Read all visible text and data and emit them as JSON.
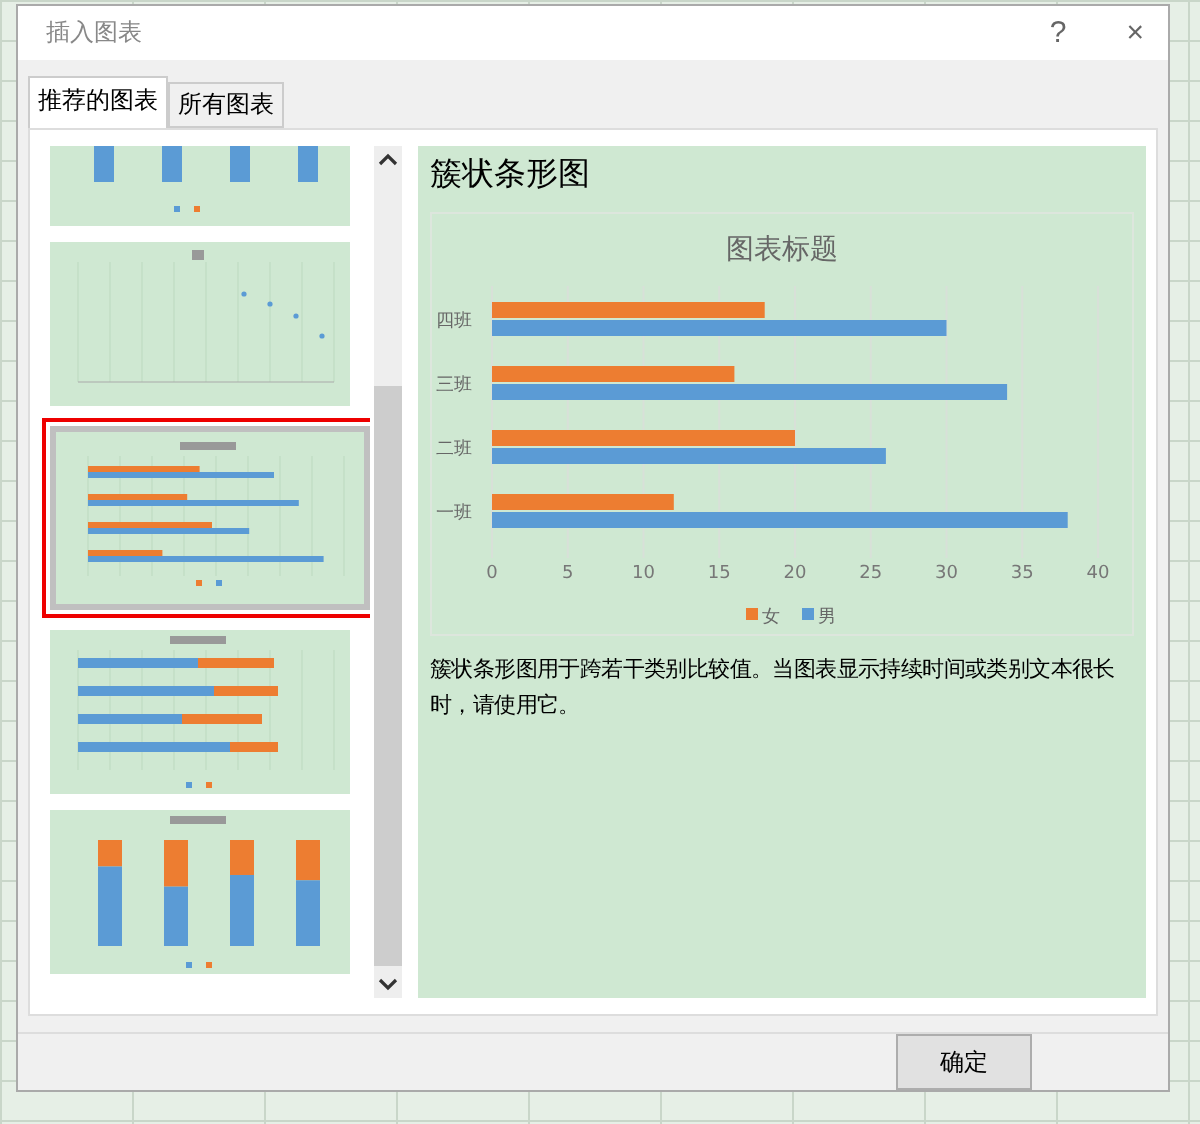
{
  "window": {
    "title": "插入图表",
    "help": "?",
    "close": "×"
  },
  "tabs": [
    {
      "label": "推荐的图表",
      "selected": true
    },
    {
      "label": "所有图表",
      "selected": false
    }
  ],
  "thumbnails": [
    {
      "kind": "column",
      "selected": false
    },
    {
      "kind": "scatter",
      "selected": false
    },
    {
      "kind": "bar",
      "selected": true
    },
    {
      "kind": "stacked-bar",
      "selected": false
    },
    {
      "kind": "percent-column",
      "selected": false
    }
  ],
  "preview": {
    "heading": "簇状条形图",
    "description": "簇状条形图用于跨若干类别比较值。当图表显示持续时间或类别文本很长时，请使用它。",
    "chart_data": {
      "type": "bar",
      "orientation": "horizontal",
      "title": "图表标题",
      "categories": [
        "四班",
        "三班",
        "二班",
        "一班"
      ],
      "series": [
        {
          "name": "女",
          "color": "#ed7d31",
          "values": [
            18,
            16,
            20,
            12
          ]
        },
        {
          "name": "男",
          "color": "#5b9bd5",
          "values": [
            30,
            34,
            26,
            38
          ]
        }
      ],
      "grid": true,
      "legend": true,
      "xlim": [
        0,
        40
      ],
      "xticks": [
        0,
        5,
        10,
        15,
        20,
        25,
        30,
        35,
        40
      ]
    }
  },
  "buttons": [
    "确定"
  ]
}
